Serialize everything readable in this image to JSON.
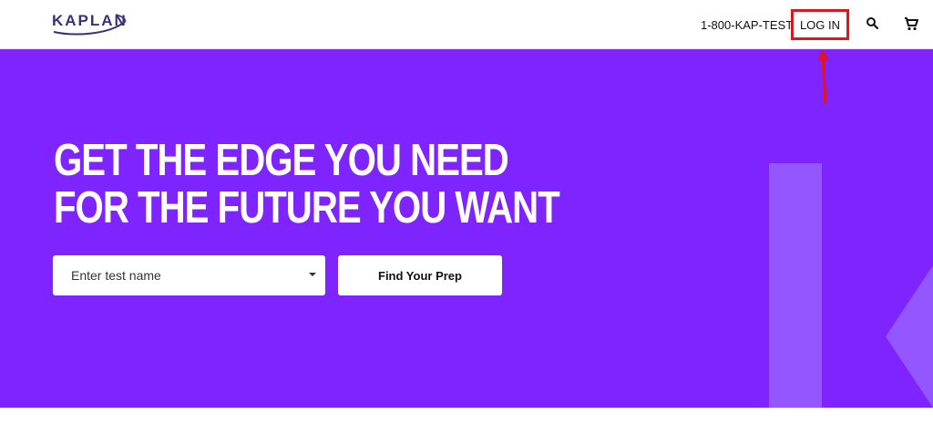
{
  "header": {
    "logo_text": "KAPLAN",
    "phone": "1-800-KAP-TEST",
    "login_label": "LOG IN",
    "icons": [
      "search-icon",
      "cart-icon"
    ]
  },
  "hero": {
    "headline_line1": "GET THE EDGE YOU NEED",
    "headline_line2": "FOR THE FUTURE YOU WANT",
    "select_placeholder": "Enter test name",
    "button_label": "Find Your Prep"
  },
  "colors": {
    "hero_bg": "#7d24ff",
    "highlight": "#e5141b",
    "logo": "#3a2f7a"
  }
}
